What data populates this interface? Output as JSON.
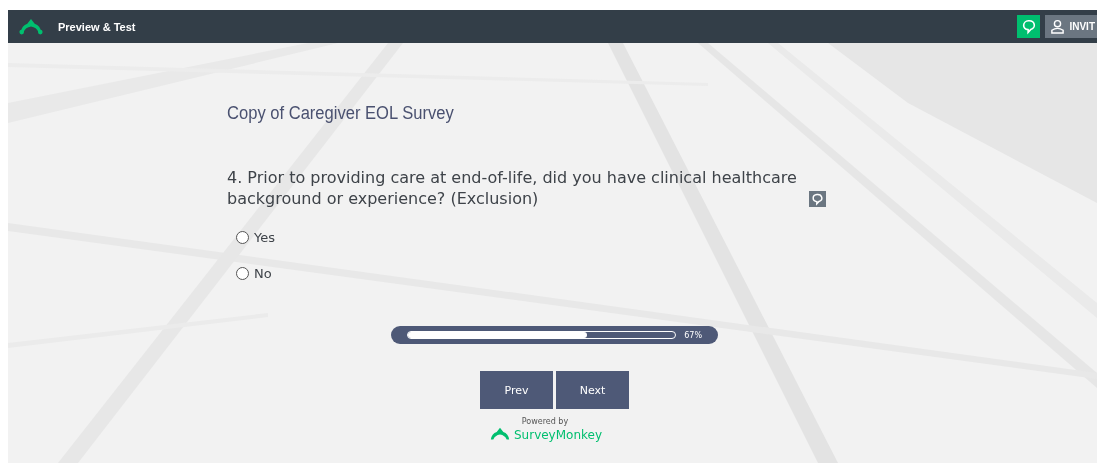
{
  "top_bar": {
    "title": "Preview & Test",
    "invite_label": "INVIT"
  },
  "survey": {
    "title": "Copy of Caregiver EOL Survey",
    "question": {
      "text": "4. Prior to providing care at end-of-life, did you have clinical healthcare background or experience? (Exclusion)",
      "options": [
        {
          "label": "Yes",
          "selected": false
        },
        {
          "label": "No",
          "selected": false
        }
      ]
    },
    "progress": {
      "level": 0.67,
      "reading": "67%"
    },
    "buttons": [
      "Prev",
      "Next"
    ],
    "footer": {
      "powered_by": "Powered by",
      "brand": "SurveyMonkey"
    }
  }
}
